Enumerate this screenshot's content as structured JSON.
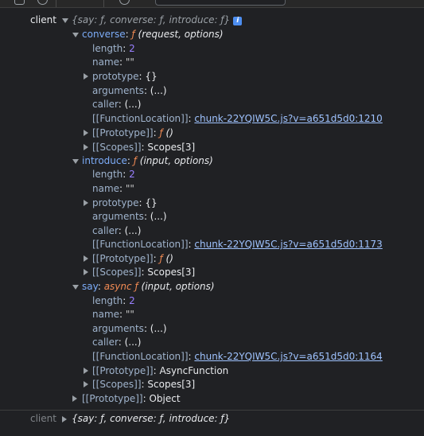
{
  "colors": {
    "bg": "#202124",
    "key": "#7cacf8",
    "key_dim": "#9fb3cc",
    "string": "#c8c8c8",
    "number": "#9980ff",
    "function_keyword": "#f28b54",
    "link": "#9fc3ff",
    "info": "#4d8ef0"
  },
  "toolbar": {
    "icons": [
      "sidebar-icon",
      "clear-console-icon",
      "eye-icon"
    ],
    "filter_placeholder": ""
  },
  "root": {
    "name": "client",
    "preview": {
      "open": "{",
      "k1": "say",
      "v1": "ƒ",
      "k2": "converse",
      "v2": "ƒ",
      "k3": "introduce",
      "v3": "ƒ",
      "close": "}"
    },
    "info_icon": "i"
  },
  "converse": {
    "key": "converse",
    "f": "ƒ",
    "sig": "(request, options)",
    "length_key": "length",
    "length_val": "2",
    "name_key": "name",
    "name_val": "\"\"",
    "prototype_key": "prototype",
    "prototype_val": "{}",
    "arguments_key": "arguments",
    "arguments_val": "(...)",
    "caller_key": "caller",
    "caller_val": "(...)",
    "fl_key": "[[FunctionLocation]]",
    "fl_val": "chunk-22YQIW5C.js?v=a651d5d0:1210",
    "proto_key": "[[Prototype]]",
    "proto_f": "ƒ",
    "proto_sig": "()",
    "scopes_key": "[[Scopes]]",
    "scopes_val": "Scopes[3]"
  },
  "introduce": {
    "key": "introduce",
    "f": "ƒ",
    "sig": "(input, options)",
    "length_key": "length",
    "length_val": "2",
    "name_key": "name",
    "name_val": "\"\"",
    "prototype_key": "prototype",
    "prototype_val": "{}",
    "arguments_key": "arguments",
    "arguments_val": "(...)",
    "caller_key": "caller",
    "caller_val": "(...)",
    "fl_key": "[[FunctionLocation]]",
    "fl_val": "chunk-22YQIW5C.js?v=a651d5d0:1173",
    "proto_key": "[[Prototype]]",
    "proto_f": "ƒ",
    "proto_sig": "()",
    "scopes_key": "[[Scopes]]",
    "scopes_val": "Scopes[3]"
  },
  "say": {
    "key": "say",
    "async": "async",
    "f": "ƒ",
    "sig": "(input, options)",
    "length_key": "length",
    "length_val": "2",
    "name_key": "name",
    "name_val": "\"\"",
    "arguments_key": "arguments",
    "arguments_val": "(...)",
    "caller_key": "caller",
    "caller_val": "(...)",
    "fl_key": "[[FunctionLocation]]",
    "fl_val": "chunk-22YQIW5C.js?v=a651d5d0:1164",
    "proto_key": "[[Prototype]]",
    "proto_val": "AsyncFunction",
    "scopes_key": "[[Scopes]]",
    "scopes_val": "Scopes[3]"
  },
  "root_proto": {
    "key": "[[Prototype]]",
    "val": "Object"
  },
  "repeat": {
    "name": "client",
    "preview": {
      "open": "{",
      "k1": "say",
      "v1": "ƒ",
      "k2": "converse",
      "v2": "ƒ",
      "k3": "introduce",
      "v3": "ƒ",
      "close": "}"
    }
  }
}
